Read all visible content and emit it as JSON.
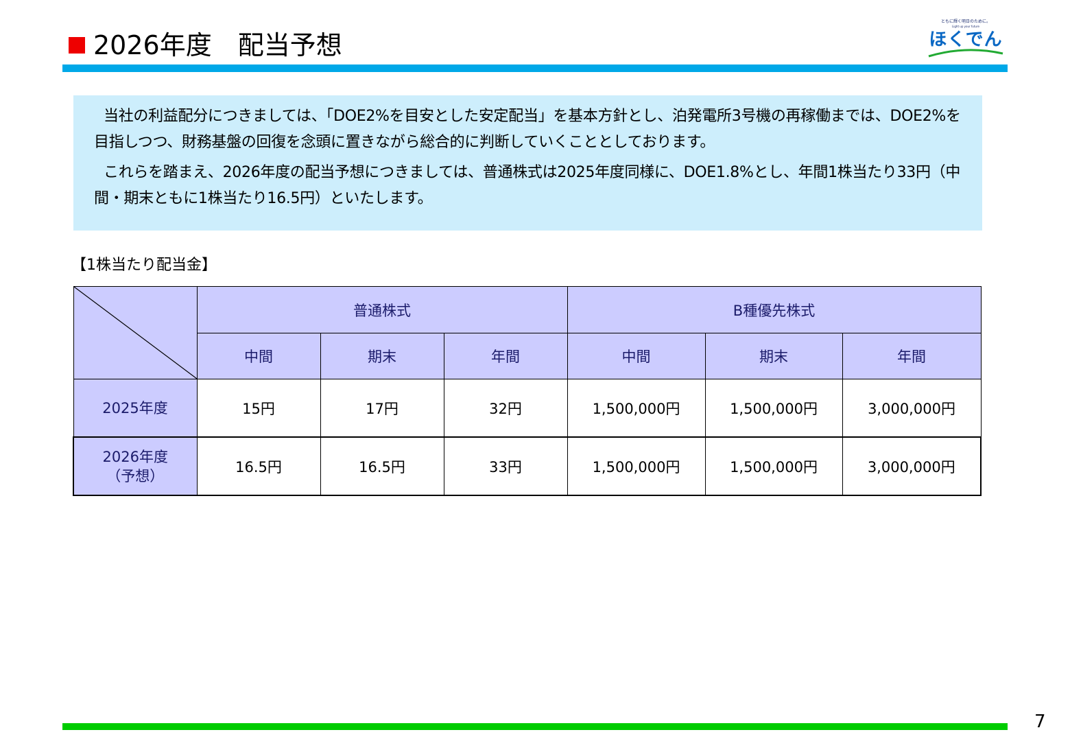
{
  "header": {
    "title": "2026年度　配当予想",
    "marker_color": "#ee0000",
    "rule_color": "#00a8e8"
  },
  "logo": {
    "tagline": "ともに輝く明日のために。",
    "subline": "Light up your future",
    "wordmark": "ほくでん"
  },
  "intro": {
    "paragraphs": [
      "当社の利益配分につきましては、「DOE2%を目安とした安定配当」を基本方針とし、泊発電所3号機の再稼働までは、DOE2%を目指しつつ、財務基盤の回復を念頭に置きながら総合的に判断していくこととしております。",
      "これらを踏まえ、2026年度の配当予想につきましては、普通株式は2025年度同様に、DOE1.8%とし、年間1株当たり33円（中間・期末ともに1株当たり16.5円）といたします。"
    ],
    "background": "#cdeefc"
  },
  "dividend_table": {
    "label": "【1株当たり配当金】",
    "groups": [
      "普通株式",
      "B種優先株式"
    ],
    "columns": [
      "中間",
      "期末",
      "年間",
      "中間",
      "期末",
      "年間"
    ],
    "rows": [
      {
        "year": "2025年度",
        "note": "",
        "values": [
          "15円",
          "17円",
          "32円",
          "1,500,000円",
          "1,500,000円",
          "3,000,000円"
        ]
      },
      {
        "year": "2026年度",
        "note": "（予想）",
        "values": [
          "16.5円",
          "16.5円",
          "33円",
          "1,500,000円",
          "1,500,000円",
          "3,000,000円"
        ]
      }
    ],
    "header_color": "#ccccff"
  },
  "footer": {
    "page_number": "7",
    "rule_color": "#00cc00"
  }
}
